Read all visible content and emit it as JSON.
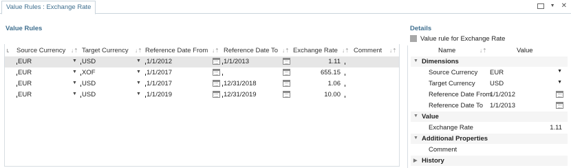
{
  "tab": {
    "label": "Value Rules : Exchange Rate"
  },
  "left": {
    "title": "Value Rules",
    "columns": [
      {
        "label": "Source Currency"
      },
      {
        "label": "Target Currency"
      },
      {
        "label": "Reference Date From"
      },
      {
        "label": "Reference Date To"
      },
      {
        "label": "Exchange Rate"
      },
      {
        "label": "Comment"
      }
    ],
    "rows": [
      {
        "source": "EUR",
        "target": "USD",
        "from": "1/1/2012",
        "to": "1/1/2013",
        "rate": "1.11",
        "comment": "",
        "selected": true
      },
      {
        "source": "EUR",
        "target": "XOF",
        "from": "1/1/2017",
        "to": "",
        "rate": "655.15",
        "comment": "",
        "selected": false
      },
      {
        "source": "EUR",
        "target": "USD",
        "from": "1/1/2017",
        "to": "12/31/2018",
        "rate": "1.06",
        "comment": "",
        "selected": false
      },
      {
        "source": "EUR",
        "target": "USD",
        "from": "1/1/2019",
        "to": "12/31/2019",
        "rate": "10.00",
        "comment": "",
        "selected": false
      }
    ]
  },
  "details": {
    "title": "Details",
    "checkbox_label": "Value rule for Exchange Rate",
    "head_name": "Name",
    "head_value": "Value",
    "dimensions_label": "Dimensions",
    "source_currency_label": "Source Currency",
    "source_currency_value": "EUR",
    "target_currency_label": "Target Currency",
    "target_currency_value": "USD",
    "ref_from_label": "Reference Date From",
    "ref_from_value": "1/1/2012",
    "ref_to_label": "Reference Date To",
    "ref_to_value": "1/1/2013",
    "value_label": "Value",
    "exchange_rate_label": "Exchange Rate",
    "exchange_rate_value": "1.11",
    "additional_label": "Additional Properties",
    "comment_label": "Comment",
    "history_label": "History"
  }
}
